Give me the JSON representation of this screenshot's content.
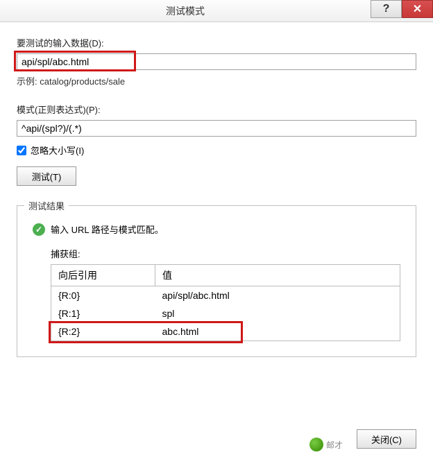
{
  "title": "测试模式",
  "input_label": "要测试的输入数据(D):",
  "input_value": "api/spl/abc.html",
  "example": "示例: catalog/products/sale",
  "pattern_label": "模式(正则表达式)(P):",
  "pattern_value": "^api/(spl?)/(.*)",
  "ignore_case_label": "忽略大小写(I)",
  "test_button": "测试(T)",
  "results": {
    "legend": "测试结果",
    "match_text": "输入 URL 路径与模式匹配。",
    "capture_label": "捕获组:",
    "columns": {
      "backref": "向后引用",
      "value": "值"
    },
    "rows": [
      {
        "ref": "{R:0}",
        "val": "api/spl/abc.html"
      },
      {
        "ref": "{R:1}",
        "val": "spl"
      },
      {
        "ref": "{R:2}",
        "val": "abc.html"
      }
    ]
  },
  "close_button": "关闭(C)",
  "watermark": "邮才"
}
